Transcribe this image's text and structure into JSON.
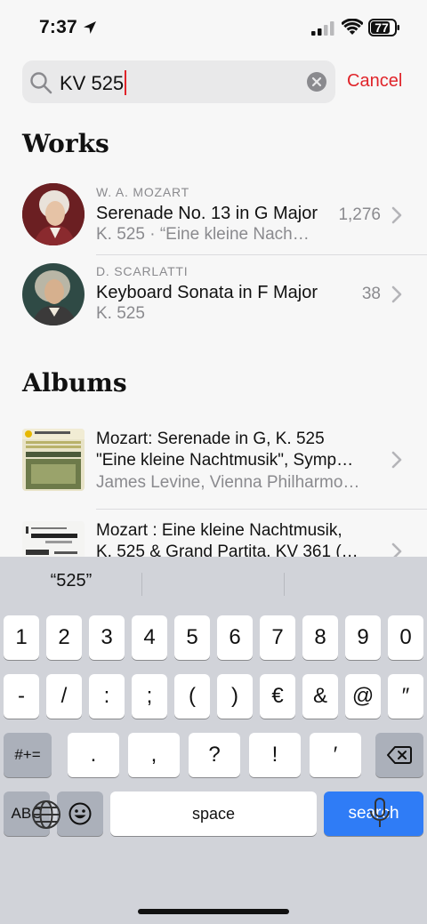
{
  "status_bar": {
    "time": "7:37",
    "battery": "77"
  },
  "search": {
    "value": "KV 525",
    "cancel_label": "Cancel"
  },
  "works": {
    "title": "Works",
    "items": [
      {
        "composer": "W. A. MOZART",
        "title": "Serenade No. 13 in G Major",
        "subtitle": "K. 525 · “Eine kleine Nach…",
        "count": "1,276"
      },
      {
        "composer": "D. SCARLATTI",
        "title": "Keyboard Sonata in F Major",
        "subtitle": "K. 525",
        "count": "38"
      }
    ]
  },
  "albums": {
    "title": "Albums",
    "items": [
      {
        "line1": "Mozart: Serenade in G, K. 525",
        "line2": "\"Eine kleine Nachtmusik\", Symp…",
        "line3": "James Levine, Vienna Philharmo…"
      },
      {
        "line1": "Mozart : Eine kleine Nachtmusik,",
        "line2": "K. 525 & Grand Partita, KV 361 (…"
      }
    ]
  },
  "keyboard": {
    "suggestion": "“525”",
    "row1": [
      "1",
      "2",
      "3",
      "4",
      "5",
      "6",
      "7",
      "8",
      "9",
      "0"
    ],
    "row2": [
      "-",
      "/",
      ":",
      ";",
      "(",
      ")",
      "€",
      "&",
      "@",
      "″"
    ],
    "row3": [
      ".",
      ",",
      "?",
      "!",
      "′"
    ],
    "symbols_label": "#+=",
    "abc_label": "ABC",
    "space_label": "space",
    "search_label": "search"
  },
  "colors": {
    "accent": "#e0242a",
    "keyboard_bg": "#d1d3d9",
    "search_key": "#2f7cf6"
  }
}
